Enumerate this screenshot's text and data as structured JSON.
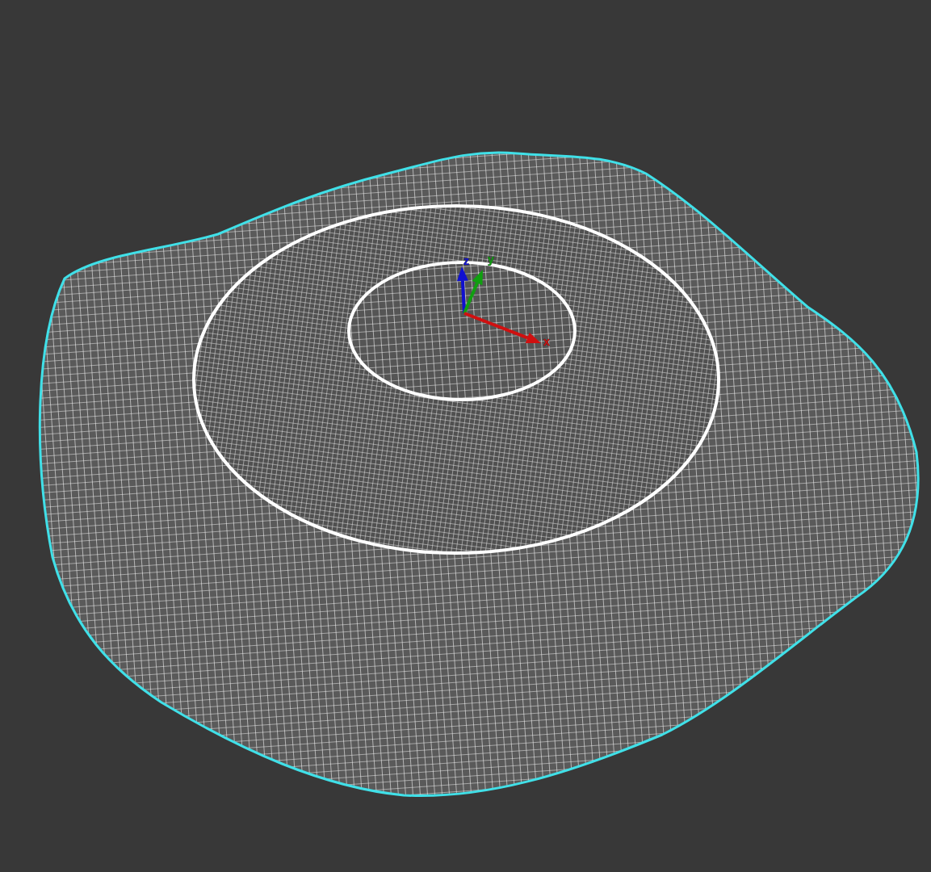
{
  "viewport": {
    "axes": [
      {
        "label": "z",
        "color": "#1010d0"
      },
      {
        "label": "y",
        "color": "#10a010"
      },
      {
        "label": "x",
        "color": "#d01010"
      }
    ]
  }
}
